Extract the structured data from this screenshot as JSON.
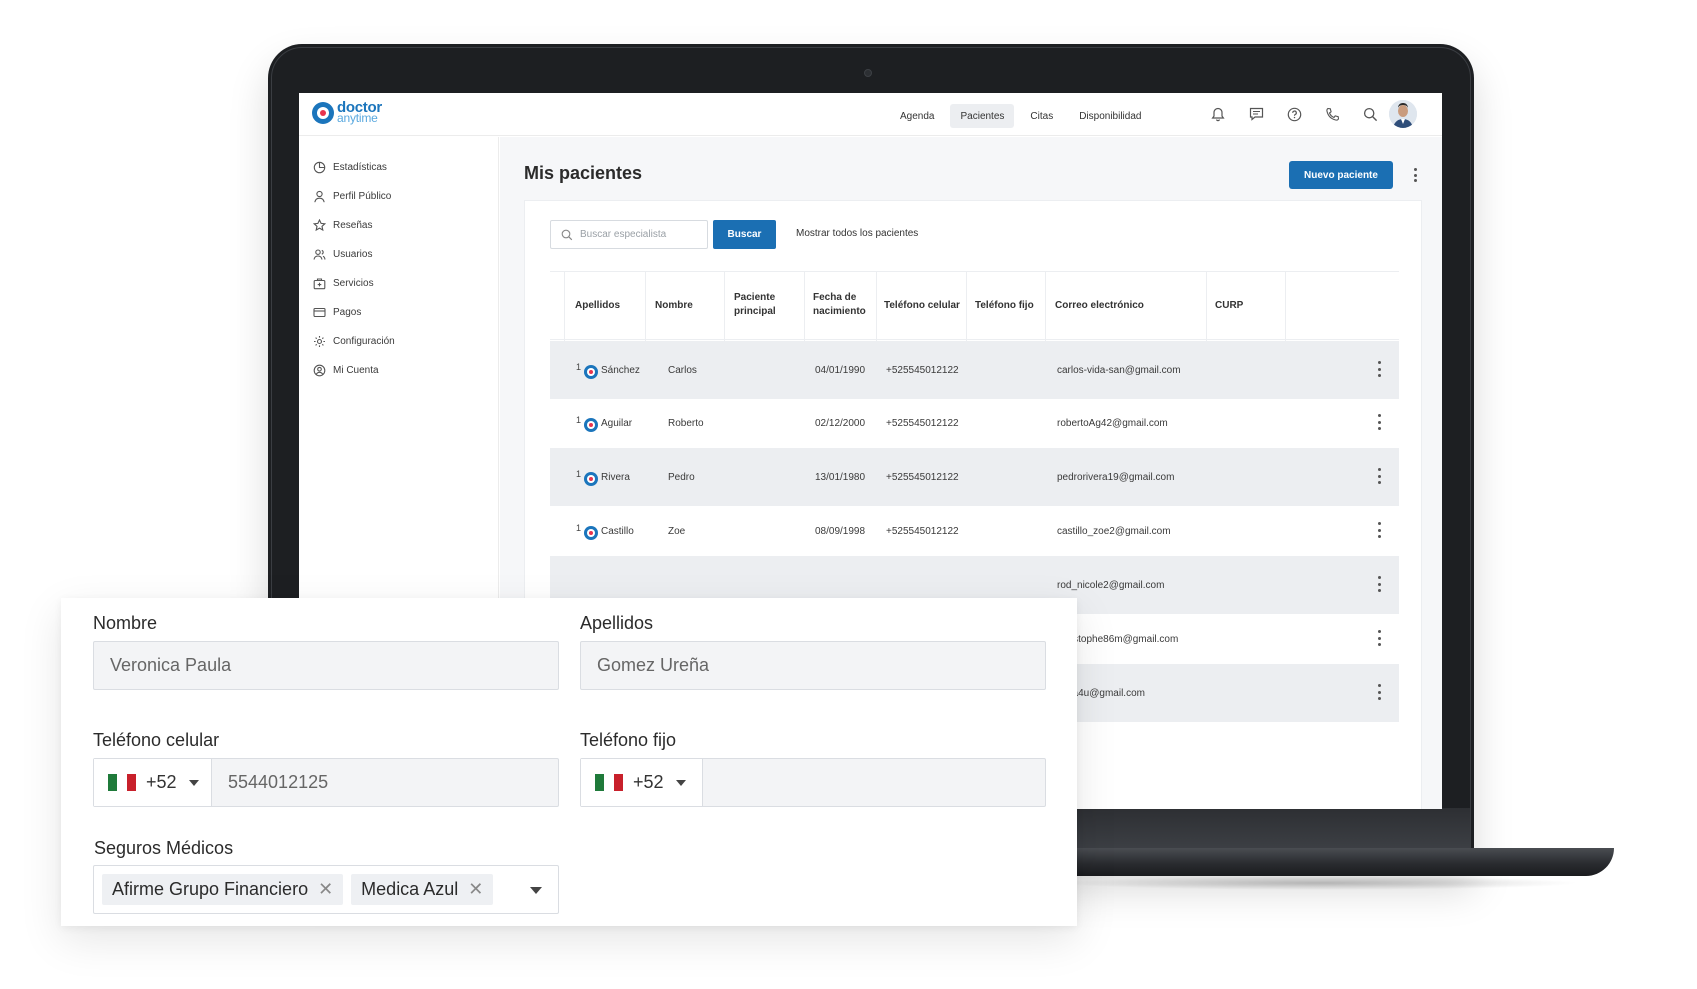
{
  "app": {
    "logo_line1": "doctor",
    "logo_line2": "anytime"
  },
  "topnav": {
    "items": [
      {
        "label": "Agenda",
        "active": false
      },
      {
        "label": "Pacientes",
        "active": true
      },
      {
        "label": "Citas",
        "active": false
      },
      {
        "label": "Disponibilidad",
        "active": false
      }
    ],
    "icons": [
      "bell-icon",
      "chat-icon",
      "help-icon",
      "phone-icon",
      "search-icon"
    ]
  },
  "sidebar": {
    "items": [
      {
        "label": "Estadísticas",
        "icon": "chart-icon"
      },
      {
        "label": "Perfil Público",
        "icon": "user-icon"
      },
      {
        "label": "Reseñas",
        "icon": "star-icon"
      },
      {
        "label": "Usuarios",
        "icon": "users-icon"
      },
      {
        "label": "Servicios",
        "icon": "medkit-icon"
      },
      {
        "label": "Pagos",
        "icon": "card-icon"
      },
      {
        "label": "Configuración",
        "icon": "gear-icon"
      },
      {
        "label": "Mi Cuenta",
        "icon": "account-icon"
      }
    ]
  },
  "main": {
    "title": "Mis pacientes",
    "new_button": "Nuevo paciente",
    "search": {
      "placeholder": "Buscar especialista",
      "button": "Buscar",
      "show_all": "Mostrar todos los pacientes"
    },
    "table": {
      "headers": {
        "apellidos": "Apellidos",
        "nombre": "Nombre",
        "principal_1": "Paciente",
        "principal_2": "principal",
        "fecha_1": "Fecha de",
        "fecha_2": "nacimiento",
        "celular": "Teléfono celular",
        "fijo": "Teléfono fijo",
        "correo": "Correo electrónico",
        "curp": "CURP"
      },
      "rows": [
        {
          "num": "1",
          "apellido": "Sánchez",
          "nombre": "Carlos",
          "fecha": "04/01/1990",
          "celular": "+525545012122",
          "correo": "carlos-vida-san@gmail.com"
        },
        {
          "num": "1",
          "apellido": "Aguilar",
          "nombre": "Roberto",
          "fecha": "02/12/2000",
          "celular": "+525545012122",
          "correo": "robertoAg42@gmail.com"
        },
        {
          "num": "1",
          "apellido": "Rivera",
          "nombre": "Pedro",
          "fecha": "13/01/1980",
          "celular": "+525545012122",
          "correo": "pedrorivera19@gmail.com"
        },
        {
          "num": "1",
          "apellido": "Castillo",
          "nombre": "Zoe",
          "fecha": "08/09/1998",
          "celular": "+525545012122",
          "correo": "castillo_zoe2@gmail.com"
        },
        {
          "correo": "rod_nicole2@gmail.com"
        },
        {
          "correo": "christophe86m@gmail.com"
        },
        {
          "correo": "sofia4u@gmail.com"
        }
      ]
    }
  },
  "form": {
    "nombre_label": "Nombre",
    "nombre_value": "Veronica Paula",
    "apellidos_label": "Apellidos",
    "apellidos_value": "Gomez Ureña",
    "celular_label": "Teléfono celular",
    "celular_prefix": "+52",
    "celular_value": "5544012125",
    "fijo_label": "Teléfono fijo",
    "fijo_prefix": "+52",
    "fijo_value": "",
    "seguros_label": "Seguros Médicos",
    "seguros_tags": [
      "Afirme Grupo Financiero",
      "Medica Azul"
    ]
  },
  "colors": {
    "primary": "#1b6fb3",
    "brand_red": "#e8344e",
    "row_shade": "#eceef1"
  }
}
